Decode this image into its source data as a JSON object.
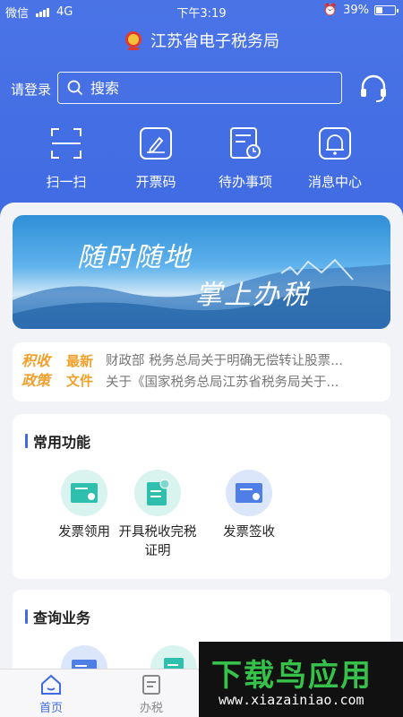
{
  "status_bar": {
    "carrier": "微信",
    "network": "4G",
    "time": "下午3:19",
    "battery": "39%"
  },
  "header": {
    "title": "江苏省电子税务局"
  },
  "search": {
    "login_label": "请登录",
    "placeholder": "搜索"
  },
  "quick_actions": [
    {
      "label": "扫一扫",
      "icon": "scan-icon"
    },
    {
      "label": "开票码",
      "icon": "invoice-code-icon"
    },
    {
      "label": "待办事项",
      "icon": "todo-icon"
    },
    {
      "label": "消息中心",
      "icon": "bell-icon"
    }
  ],
  "banner": {
    "line1": "随时随地",
    "line2": "掌上办税"
  },
  "news": {
    "badge_line1": "积收",
    "badge_line2": "政策",
    "tag_line1": "最新",
    "tag_line2": "文件",
    "items": [
      "财政部 税务总局关于明确无偿转让股票...",
      "关于《国家税务总局江苏省税务局关于..."
    ]
  },
  "common_functions": {
    "title": "常用功能",
    "items": [
      {
        "label": "发票领用",
        "icon": "invoice-collect-icon"
      },
      {
        "label": "开具税收完税证明",
        "icon": "tax-certificate-icon"
      },
      {
        "label": "发票签收",
        "icon": "invoice-sign-icon"
      }
    ]
  },
  "query_business": {
    "title": "查询业务"
  },
  "tabbar": {
    "items": [
      {
        "label": "首页",
        "icon": "home-icon",
        "active": true
      },
      {
        "label": "办税",
        "icon": "document-icon",
        "active": false
      }
    ]
  },
  "watermark": {
    "brand": "下载鸟应用",
    "url": "www.xiazainiao.com"
  },
  "colors": {
    "primary": "#3f6ae2",
    "accent": "#f0a02a",
    "teal": "#2fbfae"
  }
}
